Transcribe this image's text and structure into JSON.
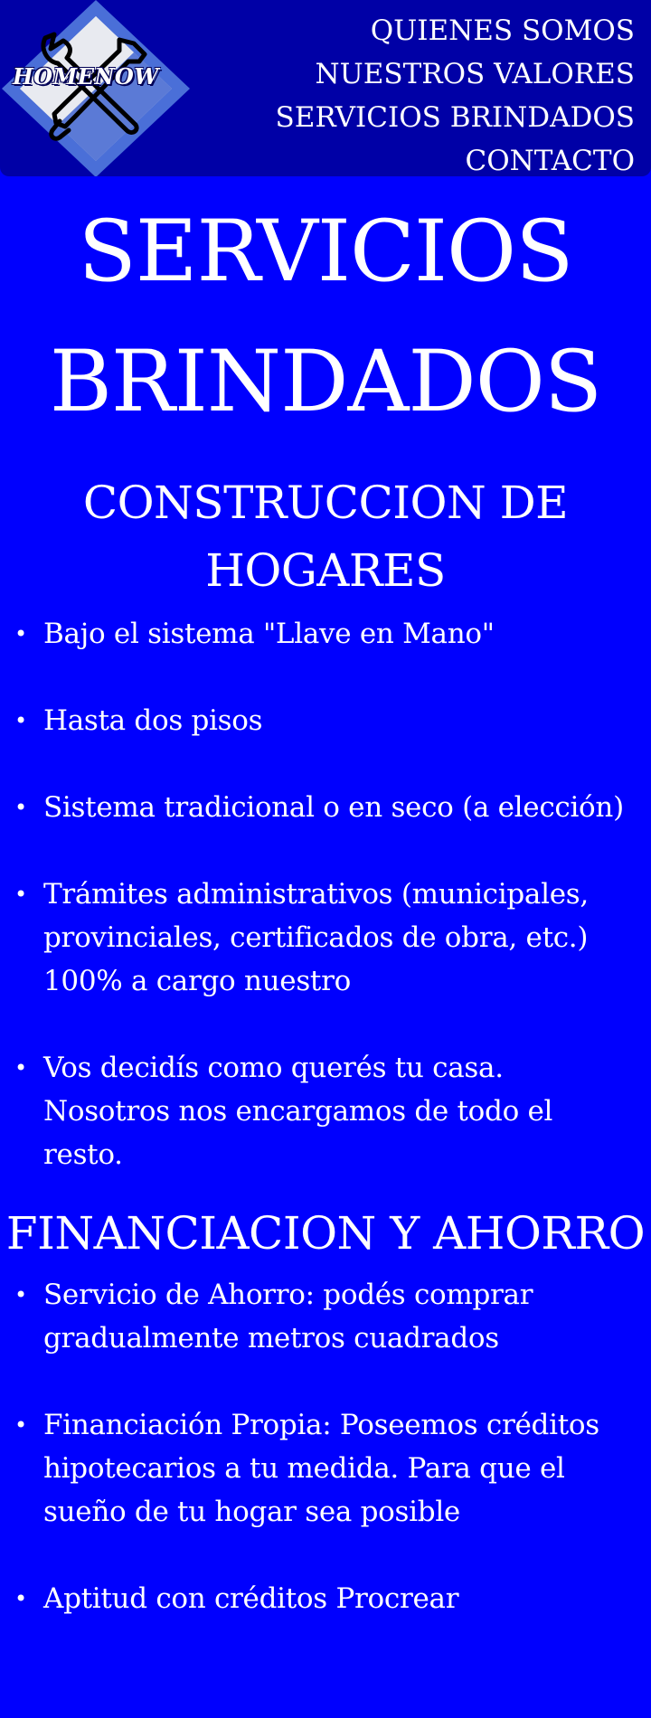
{
  "brand": {
    "logo_text": "HOMENOW",
    "colors": {
      "page_background": "#0000fe",
      "header_background": "#0000a6",
      "text": "#ffffff"
    }
  },
  "nav": {
    "items": [
      {
        "label": "QUIENES SOMOS"
      },
      {
        "label": "NUESTROS VALORES"
      },
      {
        "label": "SERVICIOS BRINDADOS"
      },
      {
        "label": "CONTACTO"
      }
    ]
  },
  "page": {
    "title": "SERVICIOS BRINDADOS"
  },
  "sections": [
    {
      "title": "CONSTRUCCION DE HOGARES",
      "items": [
        "Bajo el sistema \"Llave en Mano\"",
        "Hasta dos pisos",
        "Sistema tradicional o en seco (a elección)",
        "Trámites administrativos (municipales, provinciales, certificados de obra, etc.) 100% a cargo nuestro",
        "Vos decidís como querés tu casa. Nosotros nos encargamos de todo el resto."
      ]
    },
    {
      "title": "FINANCIACION Y AHORRO",
      "items": [
        "Servicio de Ahorro: podés comprar gradualmente metros cuadrados",
        "Financiación Propia: Poseemos créditos hipotecarios a tu medida. Para que el sueño de tu hogar sea posible",
        "Aptitud con créditos Procrear"
      ]
    }
  ],
  "icons": {
    "logo": "wrench-screwdriver-diamond-logo",
    "bullet": "bullet-dot"
  }
}
